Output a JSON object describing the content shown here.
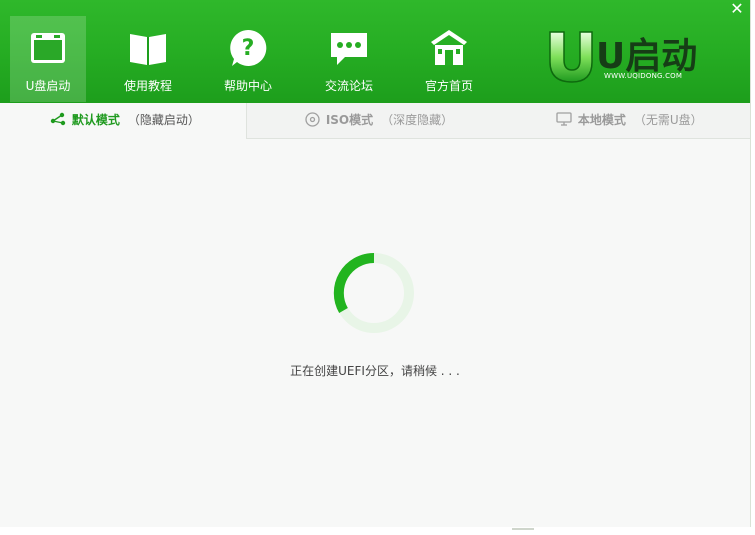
{
  "window": {
    "close_glyph": "✕"
  },
  "nav": [
    {
      "label": "U盘启动",
      "icon": "window-icon"
    },
    {
      "label": "使用教程",
      "icon": "book-icon"
    },
    {
      "label": "帮助中心",
      "icon": "help-icon"
    },
    {
      "label": "交流论坛",
      "icon": "chat-icon"
    },
    {
      "label": "官方首页",
      "icon": "home-icon"
    }
  ],
  "logo": {
    "text": "U启动",
    "url": "WWW.UQIDONG.COM"
  },
  "tabs": [
    {
      "name": "默认模式",
      "sub": "（隐藏启动）",
      "icon": "share-icon"
    },
    {
      "name": "ISO模式",
      "sub": "（深度隐藏）",
      "icon": "disc-icon"
    },
    {
      "name": "本地模式",
      "sub": "（无需U盘）",
      "icon": "monitor-icon"
    }
  ],
  "status": {
    "message": "正在创建UEFI分区，请稍候 . . ."
  },
  "colors": {
    "brand_green": "#26ad23",
    "accent_green": "#1f9a1f",
    "spinner_track": "#e8f5e7"
  }
}
